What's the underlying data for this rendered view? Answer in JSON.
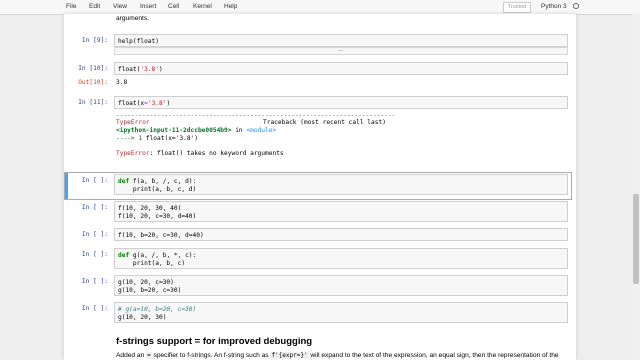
{
  "menubar": {
    "items": [
      "File",
      "Edit",
      "View",
      "Insert",
      "Cell",
      "Kernel",
      "Help"
    ],
    "trusted": "Trusted",
    "kernel_name": "Python 3"
  },
  "cells": {
    "prev_text": "arguments.",
    "c9": {
      "prompt": "In [9]:",
      "code": "help(float)",
      "collapsed": "..."
    },
    "c10": {
      "prompt": "In [10]:",
      "code_fn": "float",
      "code_arg": "'3.8'",
      "out_prompt": "Out[10]:",
      "out": "3.8"
    },
    "c11": {
      "prompt": "In [11]:",
      "code_fn": "float",
      "code_kw": "x",
      "code_arg": "'3.8'",
      "err_rule": "---------------------------------------------------------------------------",
      "err_type": "TypeError",
      "err_tb": "Traceback (most recent call last)",
      "err_loc": "<ipython-input-11-2dccbe0054b9>",
      "err_in": " in ",
      "err_module": "<module>",
      "err_arrow": "----> 1 ",
      "err_line_fn": "float",
      "err_line_kw": "x",
      "err_line_arg": "'3.8'",
      "err_msg_type": "TypeError",
      "err_msg": ": float() takes no keyword arguments"
    },
    "c12": {
      "prompt": "In [ ]:",
      "line1_kw": "def",
      "line1": " f(a, b, /, c, d):",
      "line2": "    print(a, b, c, d)"
    },
    "c13": {
      "prompt": "In [ ]:",
      "line1": "f(10, 20, 30, 40)",
      "line2": "f(10, 20, c=30, d=40)"
    },
    "c14": {
      "prompt": "In [ ]:",
      "line1": "f(10, b=20, c=30, d=40)"
    },
    "c15": {
      "prompt": "In [ ]:",
      "line1_kw": "def",
      "line1": " g(a, /, b, *, c):",
      "line2": "    print(a, b, c)"
    },
    "c16": {
      "prompt": "In [ ]:",
      "line1": "g(10, 20, c=30)",
      "line2": "g(10, b=20, c=30)"
    },
    "c17": {
      "prompt": "In [ ]:",
      "line1": "# g(a=10, b=20, c=30)",
      "line2": "g(10, 20, 30)"
    }
  },
  "markdown": {
    "heading": "f-strings support = for improved debugging",
    "p_start": "Added an ",
    "code1": "=",
    "p_mid": " specifier to f-strings. An f-string such as ",
    "code2": "f'{expr=}'",
    "p_end": " will expand to the text of the expression, an equal sign, then the representation of the"
  }
}
